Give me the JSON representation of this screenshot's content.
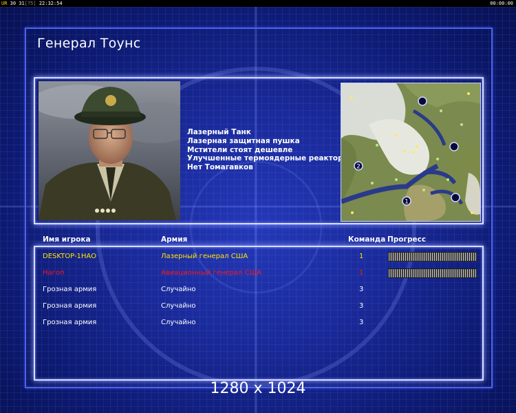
{
  "status_bar": {
    "left_prefix": "UR",
    "left_values": "30 31",
    "left_bracket": "[75]",
    "left_time": "22:32:54",
    "right_time": "00:00:00"
  },
  "title": "Генерал Тоунс",
  "features": [
    "Лазерный Танк",
    "Лазерная защитная пушка",
    "Мстители стоят дешевле",
    "Улучшенные термоядерные реакторы",
    "Нет Томагавков"
  ],
  "map": {
    "start_markers": [
      "2",
      "1"
    ]
  },
  "table": {
    "headers": {
      "player": "Имя игрока",
      "army": "Армия",
      "team": "Команда",
      "progress": "Прогресс"
    },
    "rows": [
      {
        "player": "DESKTOP-1HAO",
        "army": "Лазерный генерал США",
        "team": "1",
        "color": "#ffe600",
        "has_progress": true
      },
      {
        "player": "Hагоп",
        "army": "Авиационный генерал США",
        "team": "1",
        "color": "#ff1a1a",
        "has_progress": true
      },
      {
        "player": "Грозная армия",
        "army": "Случайно",
        "team": "3",
        "color": "#ffffff",
        "has_progress": false
      },
      {
        "player": "Грозная армия",
        "army": "Случайно",
        "team": "3",
        "color": "#ffffff",
        "has_progress": false
      },
      {
        "player": "Грозная армия",
        "army": "Случайно",
        "team": "3",
        "color": "#ffffff",
        "has_progress": false
      }
    ]
  },
  "resolution_label": "1280 x 1024"
}
